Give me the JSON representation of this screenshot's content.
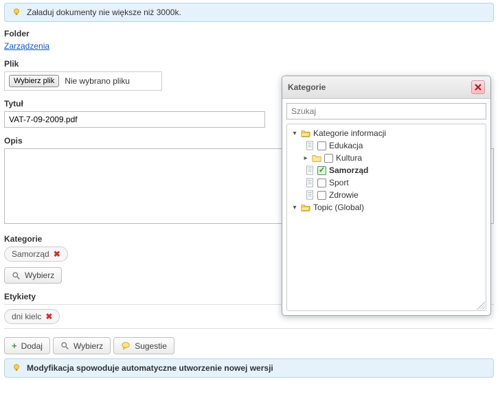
{
  "info_top": "Załaduj dokumenty nie większe niż 3000k.",
  "info_bottom": "Modyfikacja spowoduje automatyczne utworzenie nowej wersji",
  "folder": {
    "label": "Folder",
    "link": "Zarządzenia"
  },
  "file": {
    "label": "Plik",
    "choose_btn": "Wybierz plik",
    "status": "Nie wybrano pliku"
  },
  "title": {
    "label": "Tytuł",
    "value": "VAT-7-09-2009.pdf"
  },
  "desc": {
    "label": "Opis",
    "value": ""
  },
  "categories": {
    "label": "Kategorie",
    "tags": [
      "Samorząd"
    ],
    "choose_btn": "Wybierz"
  },
  "labels": {
    "label": "Etykiety",
    "tags": [
      "dni kielc"
    ]
  },
  "toolbar": {
    "add": "Dodaj",
    "choose": "Wybierz",
    "suggest": "Sugestie"
  },
  "dialog": {
    "title": "Kategorie",
    "search_placeholder": "Szukaj",
    "tree": {
      "root1": "Kategorie informacji",
      "edukacja": "Edukacja",
      "kultura": "Kultura",
      "samorzad": "Samorząd",
      "sport": "Sport",
      "zdrowie": "Zdrowie",
      "root2": "Topic (Global)"
    }
  }
}
